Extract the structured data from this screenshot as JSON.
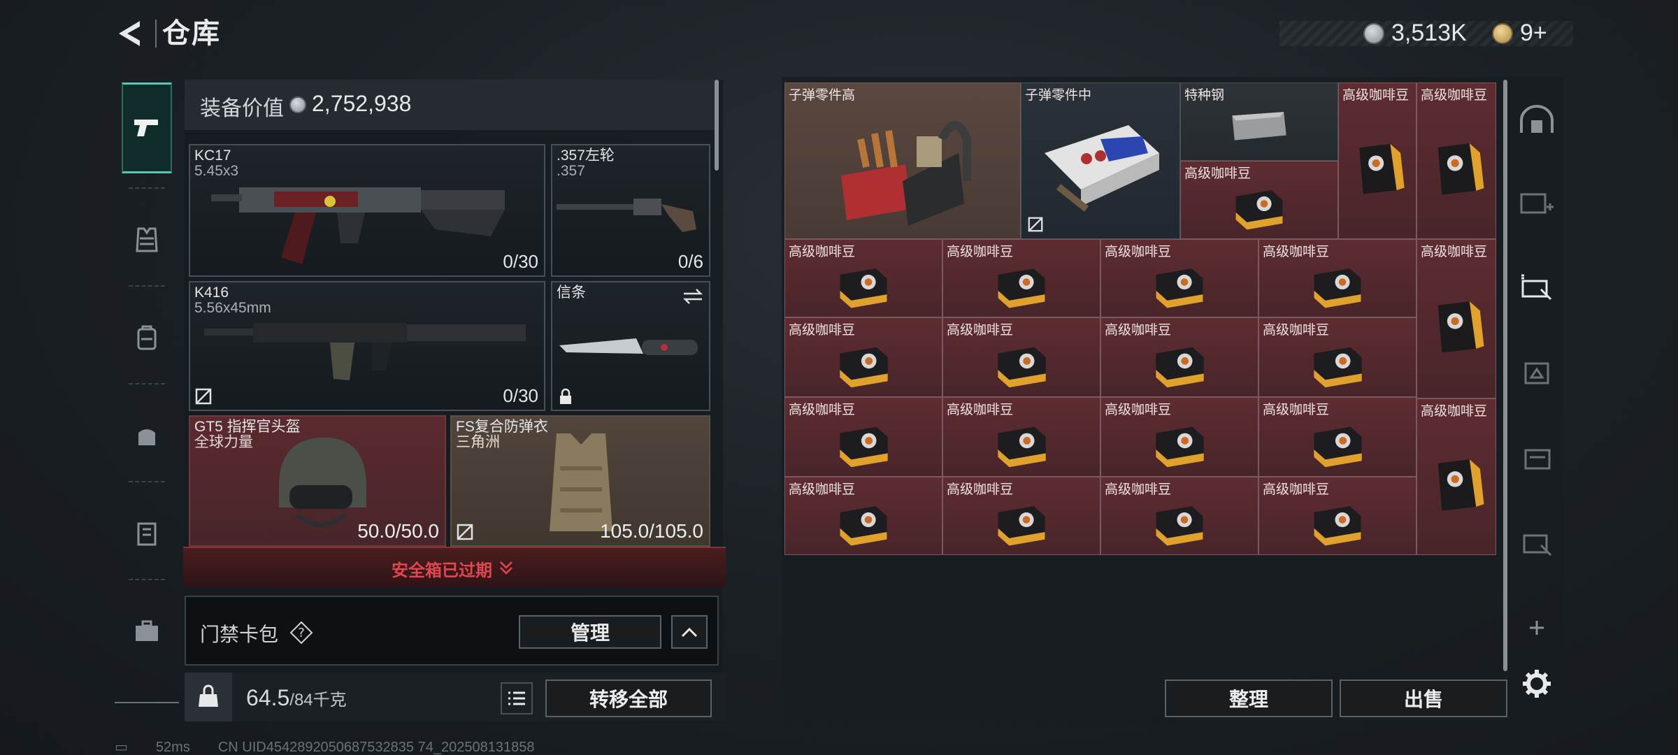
{
  "header": {
    "title": "仓库",
    "silver_amount": "3,513K",
    "gold_amount": "9+"
  },
  "left_nav": {
    "items": [
      {
        "icon": "pistol-icon",
        "active": true
      },
      {
        "icon": "vest-icon",
        "active": false
      },
      {
        "icon": "backpack-icon",
        "active": false
      },
      {
        "icon": "pouch-icon",
        "active": false
      },
      {
        "icon": "container-icon",
        "active": false
      },
      {
        "icon": "briefcase-icon",
        "active": false
      }
    ]
  },
  "loadout": {
    "value_label": "装备价值",
    "value_amount": "2,752,938",
    "slots": {
      "primary1": {
        "name": "KC17",
        "caliber": "5.45x3",
        "ammo": "0/30"
      },
      "sidearm": {
        "name": ".357左轮",
        "caliber": ".357",
        "ammo": "0/6"
      },
      "primary2": {
        "name": "K416",
        "caliber": "5.56x45mm",
        "ammo": "0/30"
      },
      "melee": {
        "name": "信条"
      },
      "helmet": {
        "name": "GT5 指挥官头盔",
        "sub": "全球力量",
        "durability": "50.0/50.0"
      },
      "armor": {
        "name": "FS复合防弹衣",
        "sub": "三角洲",
        "durability": "105.0/105.0"
      }
    },
    "safebox_notice": "安全箱已过期",
    "card_pack_label": "门禁卡包",
    "manage_label": "管理",
    "weight_value": "64.5",
    "weight_capacity": "/84千克",
    "transfer_all_label": "转移全部"
  },
  "status_bar": {
    "ping": "52ms",
    "uid": "CN UID4542892050687532835 74_202508131858"
  },
  "storage": {
    "items": [
      {
        "label": "子弹零件高",
        "kind": "ammo-parts-high"
      },
      {
        "label": "子弹零件中",
        "kind": "ammo-parts-mid"
      },
      {
        "label": "特种钢",
        "kind": "steel"
      },
      {
        "label": "高级咖啡豆",
        "kind": "coffee-bag"
      },
      {
        "label": "高级咖啡豆",
        "kind": "coffee-bag"
      },
      {
        "label": "高级咖啡豆",
        "kind": "coffee-box"
      },
      {
        "label": "高级咖啡豆",
        "kind": "coffee-box"
      },
      {
        "label": "高级咖啡豆",
        "kind": "coffee-box"
      },
      {
        "label": "高级咖啡豆",
        "kind": "coffee-box"
      },
      {
        "label": "高级咖啡豆",
        "kind": "coffee-box"
      },
      {
        "label": "高级咖啡豆",
        "kind": "coffee-bag"
      },
      {
        "label": "高级咖啡豆",
        "kind": "coffee-box"
      },
      {
        "label": "高级咖啡豆",
        "kind": "coffee-box"
      },
      {
        "label": "高级咖啡豆",
        "kind": "coffee-box"
      },
      {
        "label": "高级咖啡豆",
        "kind": "coffee-box"
      },
      {
        "label": "高级咖啡豆",
        "kind": "coffee-box"
      },
      {
        "label": "高级咖啡豆",
        "kind": "coffee-box"
      },
      {
        "label": "高级咖啡豆",
        "kind": "coffee-box"
      },
      {
        "label": "高级咖啡豆",
        "kind": "coffee-box"
      },
      {
        "label": "高级咖啡豆",
        "kind": "coffee-bag"
      },
      {
        "label": "高级咖啡豆",
        "kind": "coffee-box"
      },
      {
        "label": "高级咖啡豆",
        "kind": "coffee-box"
      },
      {
        "label": "高级咖啡豆",
        "kind": "coffee-box"
      },
      {
        "label": "高级咖啡豆",
        "kind": "coffee-box"
      }
    ],
    "sort_label": "整理",
    "sell_label": "出售"
  },
  "colors": {
    "accent_teal": "#57c8b2",
    "warning_red": "#e0474f",
    "item_red_bg": "#5e2c31"
  }
}
